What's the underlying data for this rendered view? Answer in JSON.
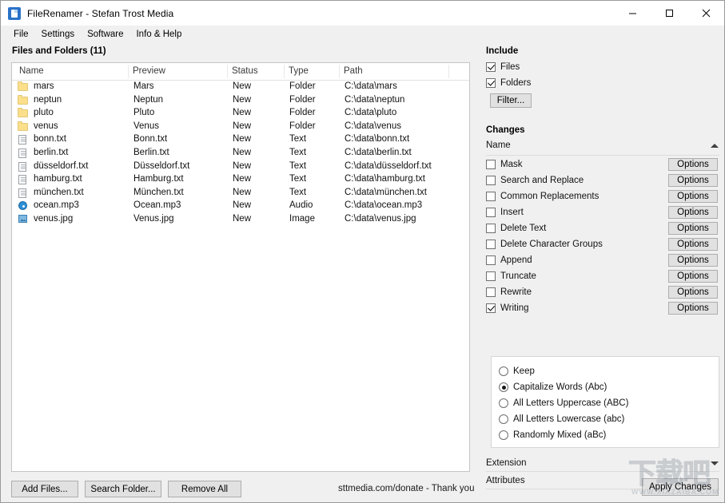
{
  "window": {
    "title": "FileRenamer - Stefan Trost Media",
    "icon": "document-icon",
    "controls": {
      "minimize": "minimize-icon",
      "maximize": "maximize-icon",
      "close": "close-icon"
    }
  },
  "menubar": {
    "items": [
      "File",
      "Settings",
      "Software",
      "Info & Help"
    ]
  },
  "left_pane": {
    "group_title": "Files and Folders (11)",
    "columns": [
      "Name",
      "Preview",
      "Status",
      "Type",
      "Path"
    ],
    "rows": [
      {
        "icon": "folder-icon",
        "name": "mars",
        "preview": "Mars",
        "status": "New",
        "type": "Folder",
        "path": "C:\\data\\mars"
      },
      {
        "icon": "folder-icon",
        "name": "neptun",
        "preview": "Neptun",
        "status": "New",
        "type": "Folder",
        "path": "C:\\data\\neptun"
      },
      {
        "icon": "folder-icon",
        "name": "pluto",
        "preview": "Pluto",
        "status": "New",
        "type": "Folder",
        "path": "C:\\data\\pluto"
      },
      {
        "icon": "folder-icon",
        "name": "venus",
        "preview": "Venus",
        "status": "New",
        "type": "Folder",
        "path": "C:\\data\\venus"
      },
      {
        "icon": "text-file-icon",
        "name": "bonn.txt",
        "preview": "Bonn.txt",
        "status": "New",
        "type": "Text",
        "path": "C:\\data\\bonn.txt"
      },
      {
        "icon": "text-file-icon",
        "name": "berlin.txt",
        "preview": "Berlin.txt",
        "status": "New",
        "type": "Text",
        "path": "C:\\data\\berlin.txt"
      },
      {
        "icon": "text-file-icon",
        "name": "düsseldorf.txt",
        "preview": "Düsseldorf.txt",
        "status": "New",
        "type": "Text",
        "path": "C:\\data\\düsseldorf.txt"
      },
      {
        "icon": "text-file-icon",
        "name": "hamburg.txt",
        "preview": "Hamburg.txt",
        "status": "New",
        "type": "Text",
        "path": "C:\\data\\hamburg.txt"
      },
      {
        "icon": "text-file-icon",
        "name": "münchen.txt",
        "preview": "München.txt",
        "status": "New",
        "type": "Text",
        "path": "C:\\data\\münchen.txt"
      },
      {
        "icon": "audio-file-icon",
        "name": "ocean.mp3",
        "preview": "Ocean.mp3",
        "status": "New",
        "type": "Audio",
        "path": "C:\\data\\ocean.mp3"
      },
      {
        "icon": "image-file-icon",
        "name": "venus.jpg",
        "preview": "Venus.jpg",
        "status": "New",
        "type": "Image",
        "path": "C:\\data\\venus.jpg"
      }
    ],
    "buttons": {
      "add_files": "Add Files...",
      "search_folder": "Search Folder...",
      "remove_all": "Remove All"
    },
    "donate_text": "sttmedia.com/donate - Thank you"
  },
  "right_pane": {
    "include": {
      "title": "Include",
      "files": {
        "label": "Files",
        "checked": true
      },
      "folders": {
        "label": "Folders",
        "checked": true
      },
      "filter_button": "Filter..."
    },
    "changes": {
      "title": "Changes",
      "name_section": {
        "label": "Name",
        "expanded": true,
        "caret": "chevron-up-icon"
      },
      "options_button_label": "Options",
      "items": [
        {
          "label": "Mask",
          "checked": false
        },
        {
          "label": "Search and Replace",
          "checked": false
        },
        {
          "label": "Common Replacements",
          "checked": false
        },
        {
          "label": "Insert",
          "checked": false
        },
        {
          "label": "Delete Text",
          "checked": false
        },
        {
          "label": "Delete Character Groups",
          "checked": false
        },
        {
          "label": "Append",
          "checked": false
        },
        {
          "label": "Truncate",
          "checked": false
        },
        {
          "label": "Rewrite",
          "checked": false
        },
        {
          "label": "Writing",
          "checked": true
        }
      ],
      "writing_options": [
        {
          "label": "Keep",
          "selected": false
        },
        {
          "label": "Capitalize Words (Abc)",
          "selected": true
        },
        {
          "label": "All Letters Uppercase (ABC)",
          "selected": false
        },
        {
          "label": "All Letters Lowercase (abc)",
          "selected": false
        },
        {
          "label": "Randomly Mixed (aBc)",
          "selected": false
        }
      ]
    },
    "extension_section": {
      "label": "Extension",
      "expanded": false,
      "caret": "chevron-down-icon"
    },
    "attributes_section": {
      "label": "Attributes",
      "expanded": false,
      "caret": "chevron-down-icon"
    },
    "apply_button": "Apply Changes"
  },
  "watermark": {
    "text": "下载吧",
    "sub": "WWW.XIAZAIBA.COM"
  },
  "colors": {
    "window_bg": "#f0f0f0",
    "list_bg": "#ffffff",
    "button_bg": "#e1e1e1",
    "button_border": "#adadad",
    "folder_icon": "#fbdf8a",
    "accent": "#2a72c8"
  }
}
